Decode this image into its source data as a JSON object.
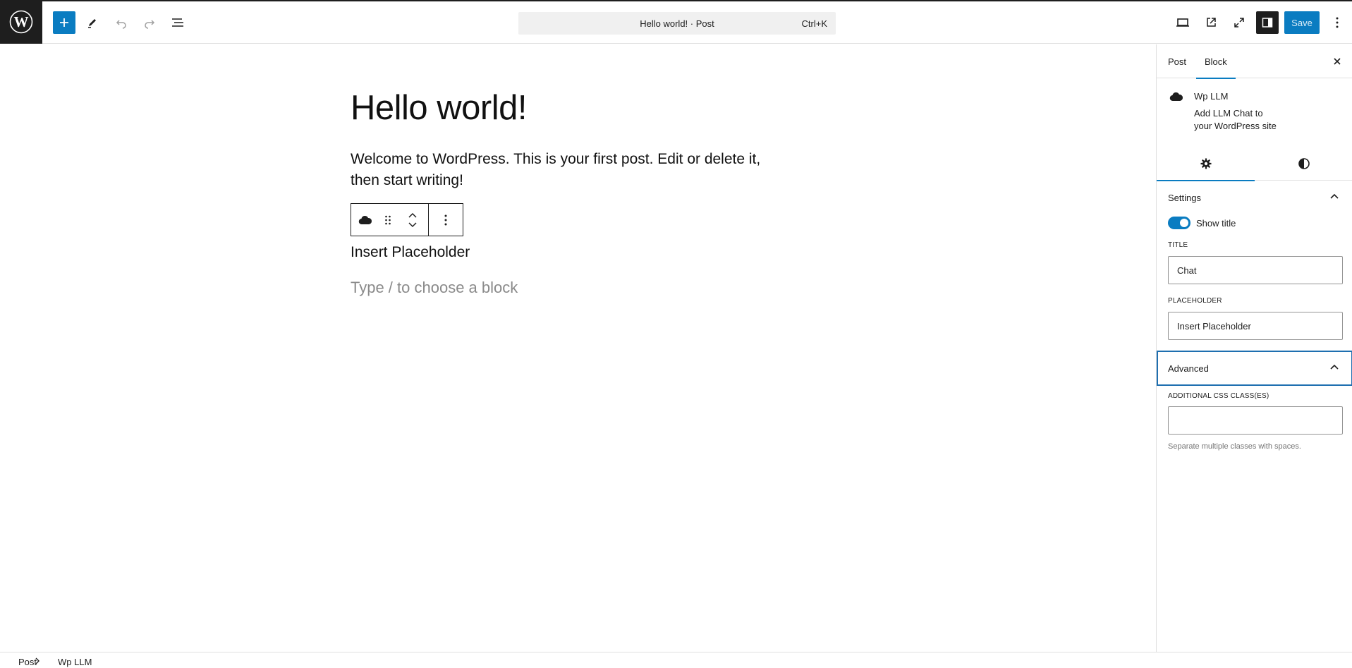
{
  "topbar": {
    "command_title": "Hello world! · Post",
    "command_shortcut": "Ctrl+K",
    "save_label": "Save",
    "accent_color": "#0a7cc1"
  },
  "editor": {
    "post_title": "Hello world!",
    "paragraph": "Welcome to WordPress. This is your first post. Edit or delete it, then start writing!",
    "block_placeholder_text": "Insert Placeholder",
    "empty_block_hint": "Type / to choose a block"
  },
  "sidebar": {
    "tabs": [
      {
        "label": "Post",
        "active": false
      },
      {
        "label": "Block",
        "active": true
      }
    ],
    "block_card": {
      "title": "Wp LLM",
      "description": "Add LLM Chat to your WordPress site"
    },
    "settings_panel": {
      "title": "Settings",
      "show_title_label": "Show title",
      "show_title_enabled": true,
      "title_field_label": "TITLE",
      "title_field_value": "Chat",
      "placeholder_field_label": "PLACEHOLDER",
      "placeholder_field_value": "Insert Placeholder"
    },
    "advanced_panel": {
      "title": "Advanced",
      "css_field_label": "ADDITIONAL CSS CLASS(ES)",
      "css_field_value": "",
      "help_text": "Separate multiple classes with spaces."
    }
  },
  "footer": {
    "breadcrumb": [
      "Post",
      "Wp LLM"
    ]
  }
}
